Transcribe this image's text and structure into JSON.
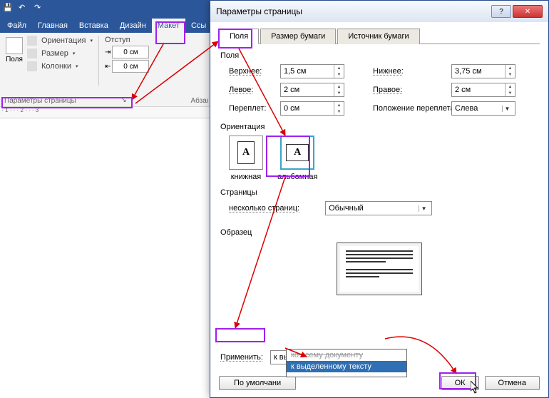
{
  "word": {
    "tabs": {
      "file": "Файл",
      "home": "Главная",
      "insert": "Вставка",
      "design": "Дизайн",
      "layout": "Макет",
      "links": "Ссы"
    },
    "ribbon": {
      "margins": "Поля",
      "orientation": "Ориентация",
      "size": "Размер",
      "columns": "Колонки",
      "indent_label": "Отступ",
      "indent_value": "0 см",
      "group_page_setup": "Параметры страницы",
      "group_paragraph": "Абзаι"
    }
  },
  "dialog": {
    "title": "Параметры страницы",
    "tabs": {
      "margins": "Поля",
      "paper": "Размер бумаги",
      "source": "Источник бумаги"
    },
    "section_margins": "Поля",
    "fields": {
      "top_label": "Верхнее:",
      "top_value": "1,5 см",
      "bottom_label": "Нижнее:",
      "bottom_value": "3,75 см",
      "left_label": "Левое:",
      "left_value": "2 см",
      "right_label": "Правое:",
      "right_value": "2 см",
      "gutter_label": "Переплет:",
      "gutter_value": "0 см",
      "gutter_pos_label": "Положение переплета:",
      "gutter_pos_value": "Слева"
    },
    "section_orientation": "Ориентация",
    "orient_portrait": "книжная",
    "orient_landscape": "альбомная",
    "section_pages": "Страницы",
    "pages_label": "несколько страниц:",
    "pages_value": "Обычный",
    "section_preview": "Образец",
    "apply_label": "Применить:",
    "apply_value": "к выделенному тексту",
    "apply_options": [
      "ко всему документу",
      "к выделенному тексту"
    ],
    "footer": {
      "default": "По умолчани",
      "ok": "ОК",
      "cancel": "Отмена"
    }
  }
}
